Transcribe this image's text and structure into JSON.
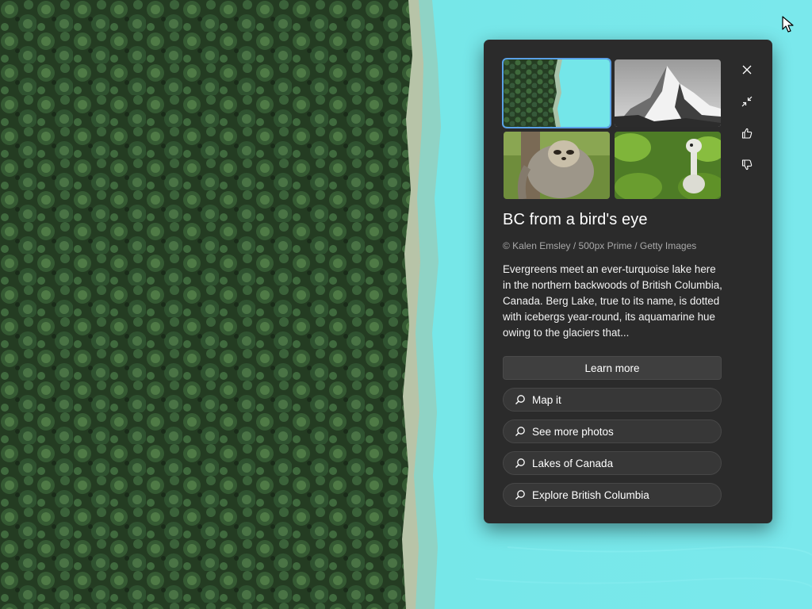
{
  "spotlight": {
    "title": "BC from a bird's eye",
    "credit": "© Kalen Emsley / 500px Prime / Getty Images",
    "description": "Evergreens meet an ever-turquoise lake here in the northern backwoods of British Columbia, Canada. Berg Lake, true to its name, is dotted with icebergs year-round, its aquamarine hue owing to the glaciers that...",
    "learn_more_label": "Learn more",
    "thumbnails": [
      {
        "name": "forest-lake-thumbnail",
        "selected": true
      },
      {
        "name": "mountain-peak-thumbnail",
        "selected": false
      },
      {
        "name": "sloth-thumbnail",
        "selected": false
      },
      {
        "name": "bird-thumbnail",
        "selected": false
      }
    ],
    "side_buttons": [
      "close-icon",
      "collapse-icon",
      "thumbs-up-icon",
      "thumbs-down-icon"
    ],
    "suggestions": [
      {
        "label": "Map it",
        "icon": "search-icon"
      },
      {
        "label": "See more photos",
        "icon": "search-icon"
      },
      {
        "label": "Lakes of Canada",
        "icon": "search-icon"
      },
      {
        "label": "Explore British Columbia",
        "icon": "search-icon"
      }
    ]
  },
  "colors": {
    "panel_bg": "#2b2b2b",
    "lake": "#6fe4e6",
    "forest": "#2e4a2c",
    "selection_accent": "#5aa0e6"
  }
}
